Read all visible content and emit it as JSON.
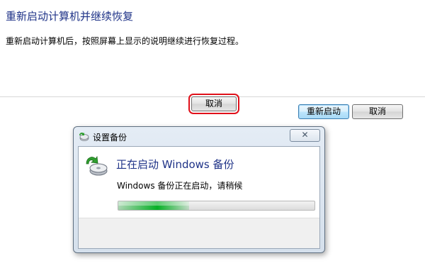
{
  "page": {
    "title": "重新启动计算机并继续恢复",
    "instruction": "重新启动计算机后，按照屏幕上显示的说明继续进行恢复过程。"
  },
  "buttons": {
    "restart": "重新启动",
    "cancel": "取消"
  },
  "dialog": {
    "title": "设置备份",
    "close_label": "✕",
    "heading": "正在启动 Windows 备份",
    "status": "Windows 备份正在启动，请稍候",
    "progress": 0.36,
    "cancel": "取消",
    "highlight_color": "#e0101a"
  },
  "icons": {
    "dialog_app": "backup-setup-icon",
    "body": "windows-backup-icon",
    "close": "close-icon"
  },
  "colors": {
    "heading_blue": "#1e3287",
    "progress_green": "#06b025"
  }
}
